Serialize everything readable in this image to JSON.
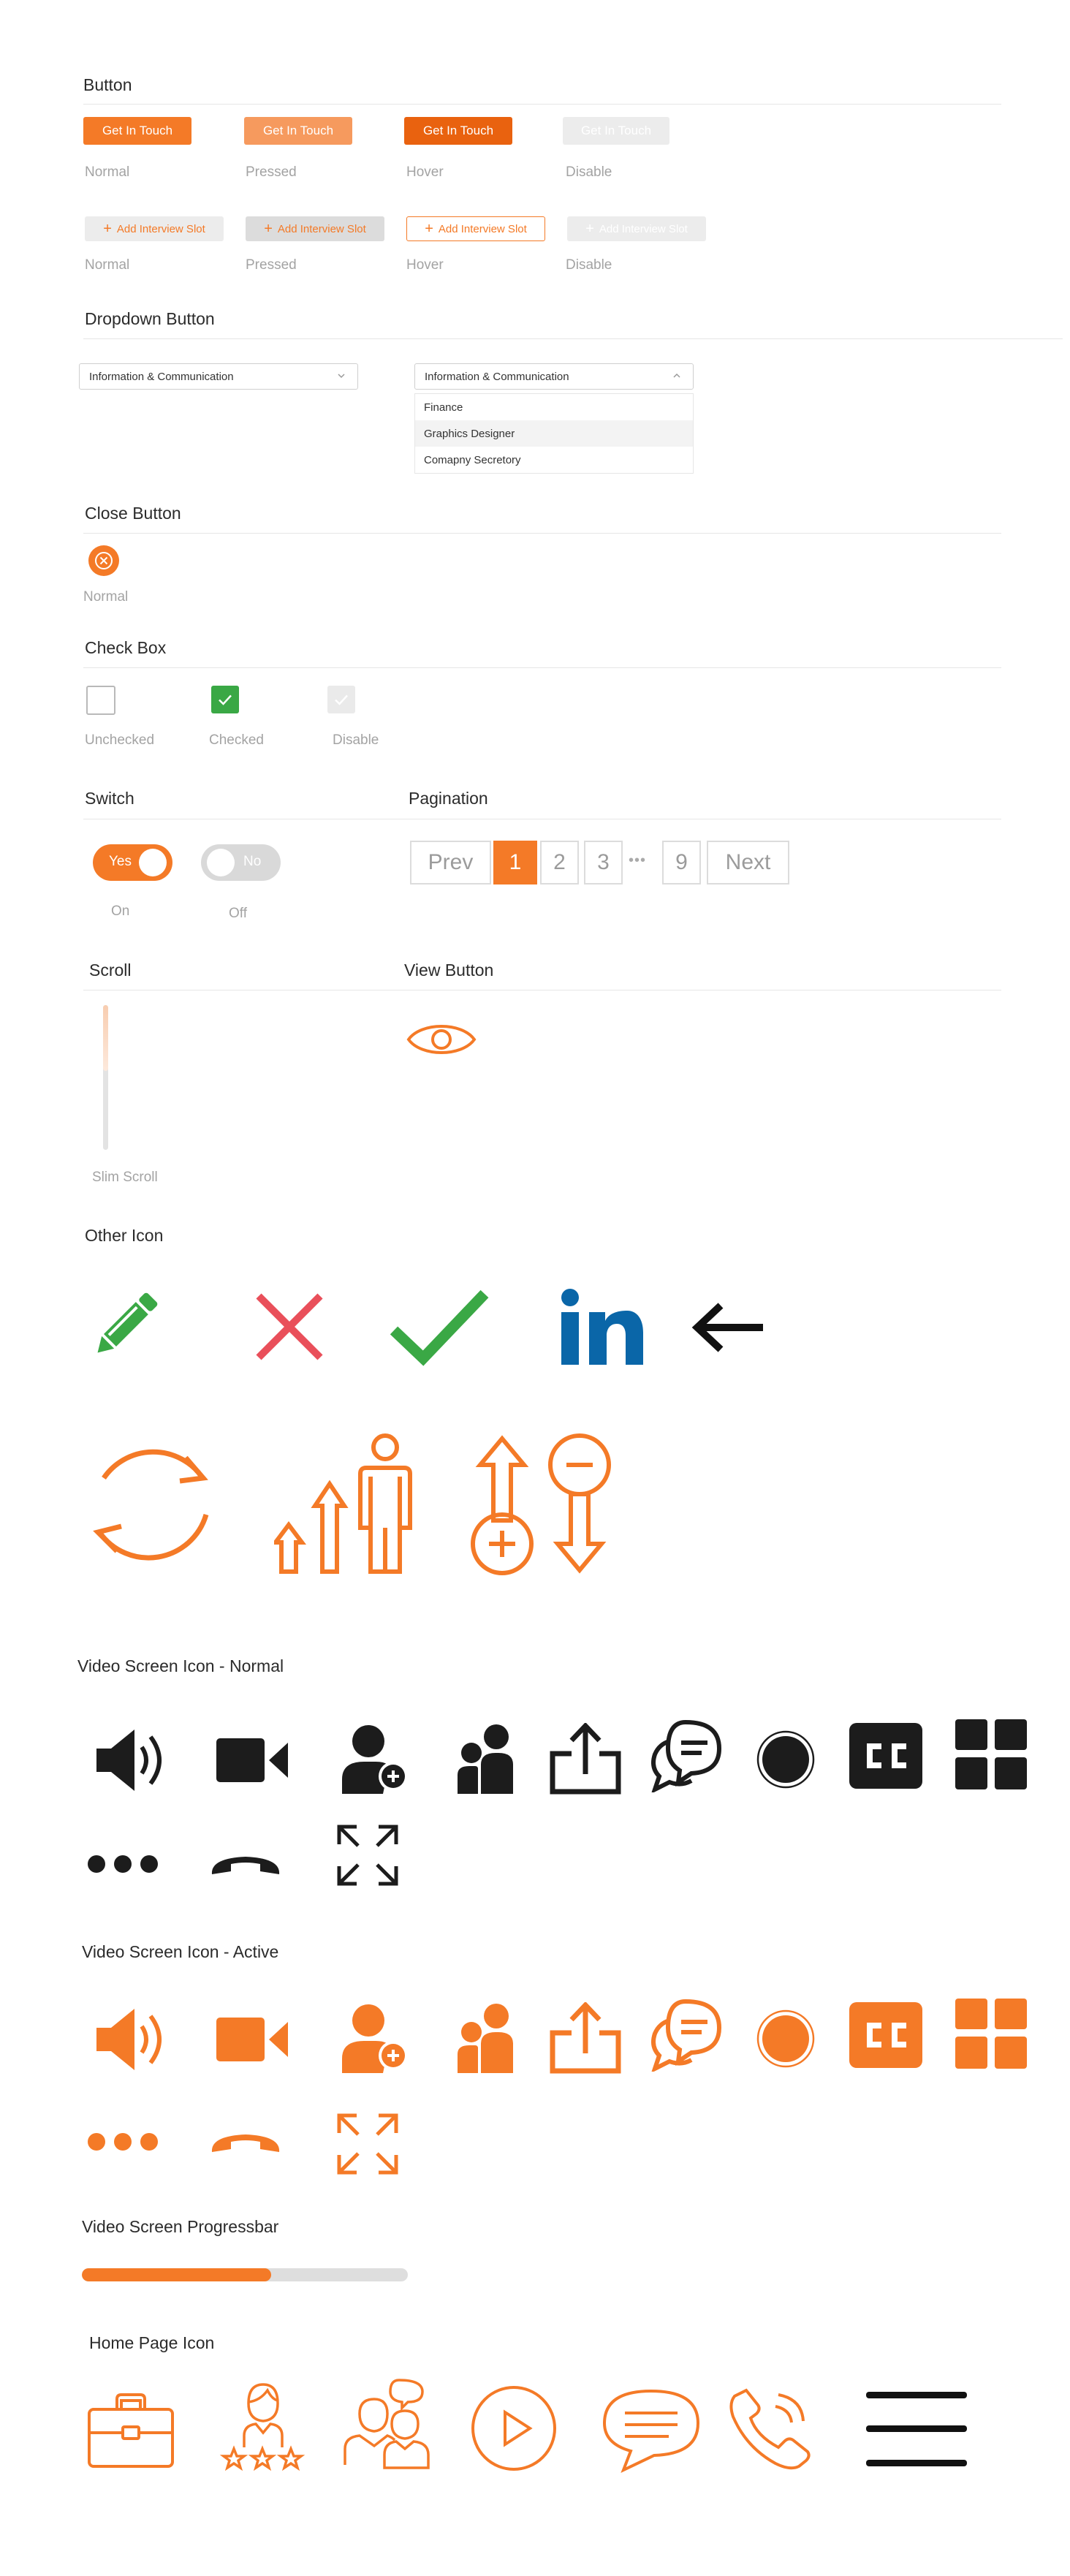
{
  "sections": {
    "button": "Button",
    "dropdown": "Dropdown Button",
    "close": "Close Button",
    "checkbox": "Check Box",
    "switch": "Switch",
    "pagination": "Pagination",
    "scroll": "Scroll",
    "view": "View Button",
    "other": "Other Icon",
    "video_normal": "Video Screen Icon - Normal",
    "video_active": "Video Screen Icon - Active",
    "progress": "Video Screen Progressbar",
    "home": "Home Page Icon"
  },
  "buttons": {
    "primary_label": "Get In Touch",
    "slot_label": "Add Interview Slot",
    "states": [
      "Normal",
      "Pressed",
      "Hover",
      "Disable"
    ]
  },
  "dropdown": {
    "selected": "Information & Communication",
    "options": [
      "Finance",
      "Graphics Designer",
      "Comapny Secretory"
    ]
  },
  "close": {
    "caption": "Normal"
  },
  "checkbox": {
    "captions": [
      "Unchecked",
      "Checked",
      "Disable"
    ]
  },
  "switch": {
    "on_label": "Yes",
    "off_label": "No",
    "on_caption": "On",
    "off_caption": "Off"
  },
  "pagination": {
    "prev": "Prev",
    "next": "Next",
    "pages": [
      "1",
      "2",
      "3",
      "9"
    ],
    "ellipsis": "•••",
    "current": "1"
  },
  "scroll": {
    "caption": "Slim Scroll"
  },
  "progress": {
    "value": 0.58
  },
  "colors": {
    "accent": "#f47a27",
    "accent_pressed": "#f69a5e",
    "accent_hover": "#e9620f",
    "disabled": "#ececec",
    "green": "#3aa845",
    "red": "#e94f5a",
    "linkedin": "#0a66a8",
    "dark": "#1c1c1c"
  },
  "icons": {
    "other": [
      "pencil-icon",
      "close-x-icon",
      "checkmark-icon",
      "linkedin-icon",
      "arrow-left-icon",
      "refresh-icon",
      "growth-person-icon",
      "zoom-in-out-icon"
    ],
    "video": [
      "speaker-icon",
      "video-camera-icon",
      "add-user-icon",
      "participants-icon",
      "share-icon",
      "chat-icon",
      "record-icon",
      "closed-caption-icon",
      "grid-icon",
      "more-icon",
      "end-call-icon",
      "fullscreen-icon"
    ],
    "home": [
      "briefcase-icon",
      "rated-candidate-icon",
      "interview-people-icon",
      "play-icon",
      "message-icon",
      "phone-call-icon",
      "menu-icon"
    ]
  }
}
